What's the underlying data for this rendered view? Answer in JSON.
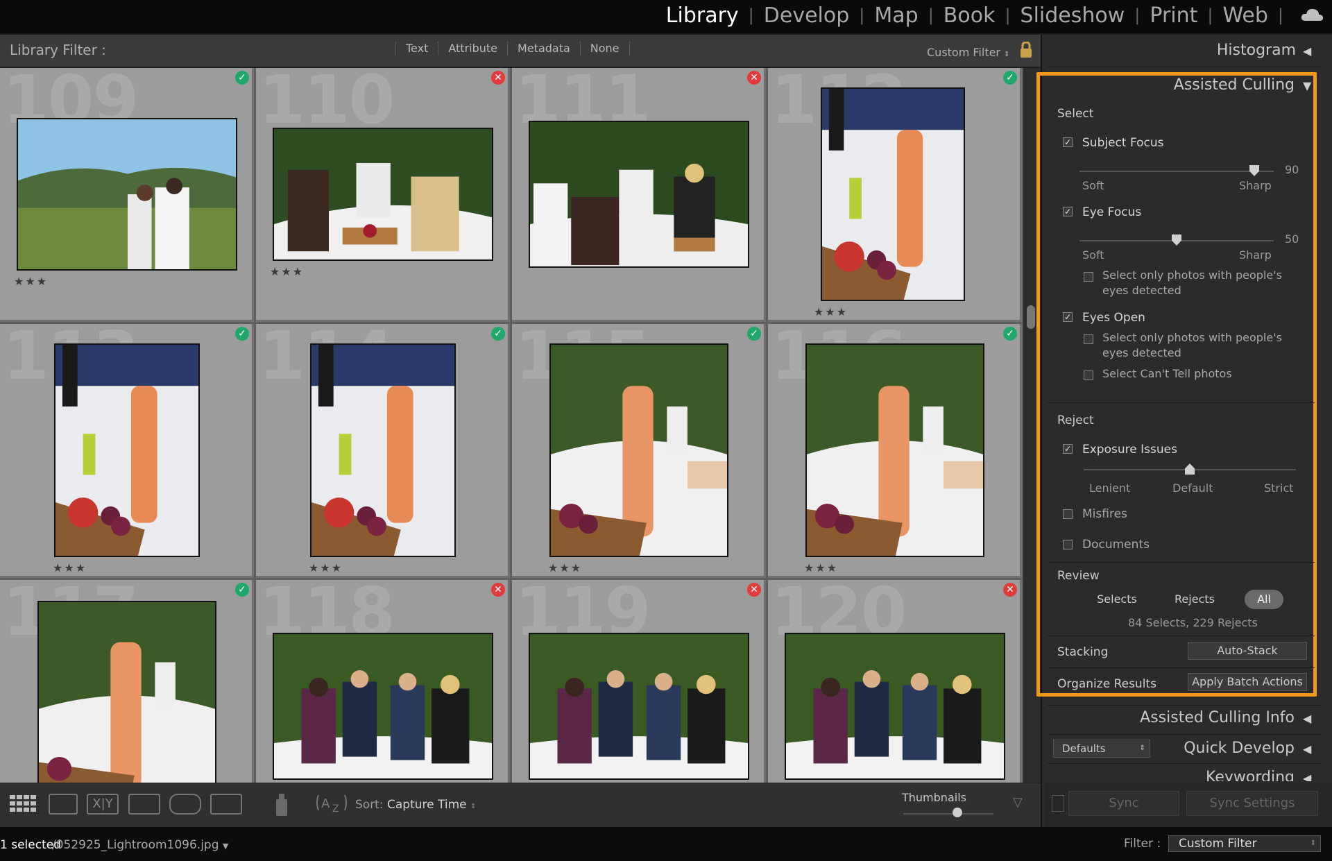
{
  "modules": {
    "items": [
      "Library",
      "Develop",
      "Map",
      "Book",
      "Slideshow",
      "Print",
      "Web"
    ],
    "active": "Library"
  },
  "filter_bar": {
    "title": "Library Filter :",
    "options": [
      "Text",
      "Attribute",
      "Metadata",
      "None"
    ],
    "custom_filter": "Custom Filter"
  },
  "grid": {
    "cells": [
      {
        "num": "109",
        "flag": "pick",
        "stars": "★★★"
      },
      {
        "num": "110",
        "flag": "reject",
        "stars": "★★★"
      },
      {
        "num": "111",
        "flag": "reject",
        "stars": ""
      },
      {
        "num": "112",
        "flag": "pick",
        "stars": "★★★"
      },
      {
        "num": "113",
        "flag": "pick",
        "stars": "★★★"
      },
      {
        "num": "114",
        "flag": "pick",
        "stars": "★★★"
      },
      {
        "num": "115",
        "flag": "pick",
        "stars": "★★★"
      },
      {
        "num": "116",
        "flag": "pick",
        "stars": "★★★"
      },
      {
        "num": "117",
        "flag": "pick",
        "stars": ""
      },
      {
        "num": "118",
        "flag": "reject",
        "stars": ""
      },
      {
        "num": "119",
        "flag": "reject",
        "stars": ""
      },
      {
        "num": "120",
        "flag": "reject",
        "stars": ""
      }
    ]
  },
  "toolbar": {
    "sort_label": "Sort:",
    "sort_value": "Capture Time",
    "thumbnails_label": "Thumbnails",
    "thumbnail_level": 0.6
  },
  "status": {
    "selected": "1 selected",
    "filename": "/052925_Lightroom1096.jpg",
    "filter_label": "Filter :",
    "filter_value": "Custom Filter"
  },
  "panel": {
    "histogram": "Histogram",
    "assisted_culling": "Assisted Culling",
    "select_label": "Select",
    "subject_focus": {
      "label": "Subject Focus",
      "checked": true,
      "value": "90",
      "level": 0.9,
      "min": "Soft",
      "max": "Sharp"
    },
    "eye_focus": {
      "label": "Eye Focus",
      "checked": true,
      "value": "50",
      "level": 0.5,
      "min": "Soft",
      "max": "Sharp"
    },
    "eye_focus_only": "Select only photos with people's eyes detected",
    "eyes_open": {
      "label": "Eyes Open",
      "checked": true
    },
    "eyes_open_only": "Select only photos with people's eyes detected",
    "cant_tell": "Select Can't Tell photos",
    "reject_label": "Reject",
    "exposure": {
      "label": "Exposure Issues",
      "checked": true,
      "level": 0.5,
      "scale": [
        "Lenient",
        "Default",
        "Strict"
      ]
    },
    "misfires": "Misfires",
    "documents": "Documents",
    "review_label": "Review",
    "review_buttons": [
      "Selects",
      "Rejects",
      "All"
    ],
    "review_summary": "84 Selects, 229 Rejects",
    "stacking_label": "Stacking",
    "auto_stack": "Auto-Stack",
    "organize_label": "Organize Results",
    "apply_batch": "Apply Batch Actions",
    "culling_info": "Assisted Culling Info",
    "quick_develop": "Quick Develop",
    "defaults": "Defaults",
    "keywording": "Keywording",
    "sync": "Sync",
    "sync_settings": "Sync Settings"
  },
  "colors": {
    "accent": "#f39a1e",
    "pick": "#1fa86a",
    "reject": "#e23b3b"
  }
}
